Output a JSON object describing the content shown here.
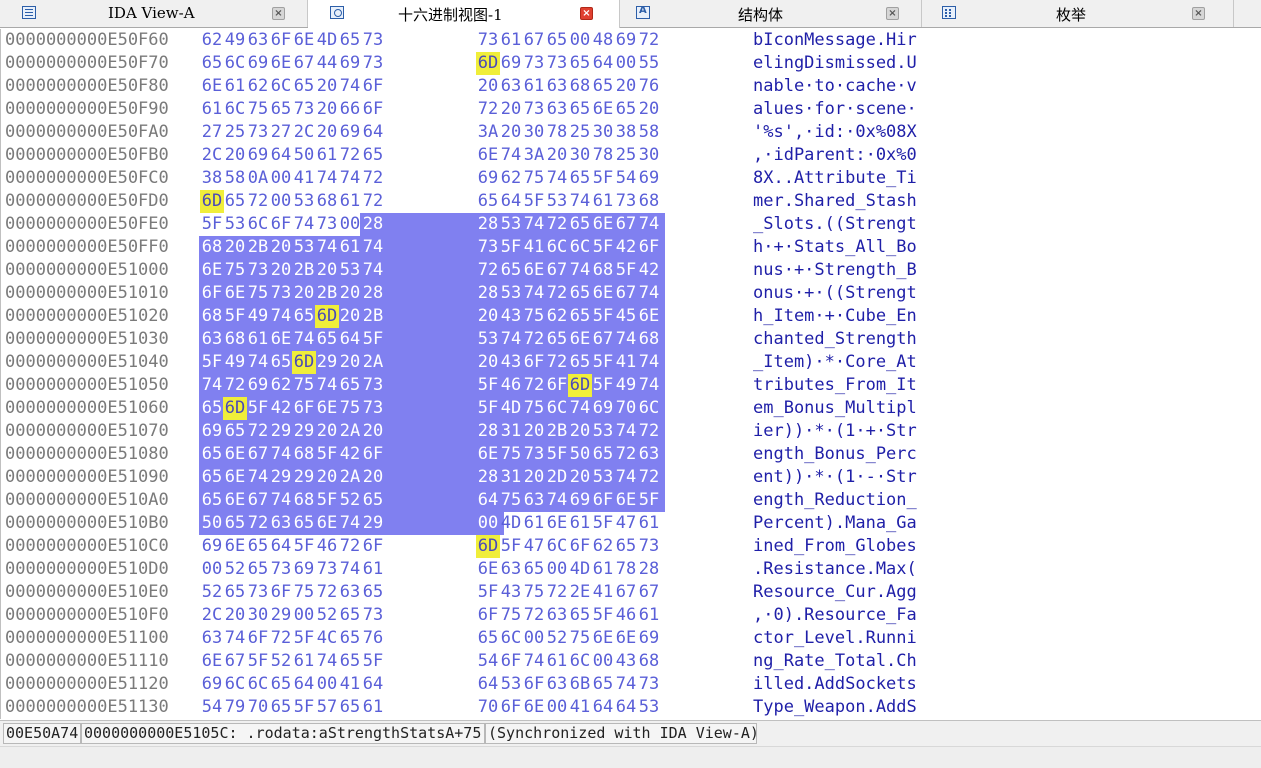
{
  "tabs": [
    {
      "label": "IDA View-A",
      "icon": "ida-view-icon",
      "active": false
    },
    {
      "label": "十六进制视图-1",
      "icon": "hex-view-icon",
      "active": true
    },
    {
      "label": "结构体",
      "icon": "structures-icon",
      "active": false
    },
    {
      "label": "枚举",
      "icon": "enums-icon",
      "active": false
    }
  ],
  "colors": {
    "hex_bytes": "#5a5fd8",
    "selection": "#8080f0",
    "search_match": "#f0ee3a",
    "ascii_text": "#1f1fa8",
    "address_text": "#7a7a7a"
  },
  "hex_rows": [
    {
      "address": "0000000000E50F60",
      "bytes": "62 49 63 6F 6E 4D 65 73 73 61 67 65 00 48 69 72",
      "ascii": "bIconMessage.Hir"
    },
    {
      "address": "0000000000E50F70",
      "bytes": "65 6C 69 6E 67 44 69 73 6D 69 73 73 65 64 00 55",
      "ascii": "elingDismissed.U"
    },
    {
      "address": "0000000000E50F80",
      "bytes": "6E 61 62 6C 65 20 74 6F 20 63 61 63 68 65 20 76",
      "ascii": "nable·to·cache·v"
    },
    {
      "address": "0000000000E50F90",
      "bytes": "61 6C 75 65 73 20 66 6F 72 20 73 63 65 6E 65 20",
      "ascii": "alues·for·scene·"
    },
    {
      "address": "0000000000E50FA0",
      "bytes": "27 25 73 27 2C 20 69 64 3A 20 30 78 25 30 38 58",
      "ascii": "'%s',·id:·0x%08X"
    },
    {
      "address": "0000000000E50FB0",
      "bytes": "2C 20 69 64 50 61 72 65 6E 74 3A 20 30 78 25 30",
      "ascii": ",·idParent:·0x%0"
    },
    {
      "address": "0000000000E50FC0",
      "bytes": "38 58 0A 00 41 74 74 72 69 62 75 74 65 5F 54 69",
      "ascii": "8X..Attribute_Ti"
    },
    {
      "address": "0000000000E50FD0",
      "bytes": "6D 65 72 00 53 68 61 72 65 64 5F 53 74 61 73 68",
      "ascii": "mer.Shared_Stash"
    },
    {
      "address": "0000000000E50FE0",
      "bytes": "5F 53 6C 6F 74 73 00 28 28 53 74 72 65 6E 67 74",
      "ascii": "_Slots.((Strengt"
    },
    {
      "address": "0000000000E50FF0",
      "bytes": "68 20 2B 20 53 74 61 74 73 5F 41 6C 6C 5F 42 6F",
      "ascii": "h·+·Stats_All_Bo"
    },
    {
      "address": "0000000000E51000",
      "bytes": "6E 75 73 20 2B 20 53 74 72 65 6E 67 74 68 5F 42",
      "ascii": "nus·+·Strength_B"
    },
    {
      "address": "0000000000E51010",
      "bytes": "6F 6E 75 73 20 2B 20 28 28 53 74 72 65 6E 67 74",
      "ascii": "onus·+·((Strengt"
    },
    {
      "address": "0000000000E51020",
      "bytes": "68 5F 49 74 65 6D 20 2B 20 43 75 62 65 5F 45 6E",
      "ascii": "h_Item·+·Cube_En"
    },
    {
      "address": "0000000000E51030",
      "bytes": "63 68 61 6E 74 65 64 5F 53 74 72 65 6E 67 74 68",
      "ascii": "chanted_Strength"
    },
    {
      "address": "0000000000E51040",
      "bytes": "5F 49 74 65 6D 29 20 2A 20 43 6F 72 65 5F 41 74",
      "ascii": "_Item)·*·Core_At"
    },
    {
      "address": "0000000000E51050",
      "bytes": "74 72 69 62 75 74 65 73 5F 46 72 6F 6D 5F 49 74",
      "ascii": "tributes_From_It"
    },
    {
      "address": "0000000000E51060",
      "bytes": "65 6D 5F 42 6F 6E 75 73 5F 4D 75 6C 74 69 70 6C",
      "ascii": "em_Bonus_Multipl"
    },
    {
      "address": "0000000000E51070",
      "bytes": "69 65 72 29 29 20 2A 20 28 31 20 2B 20 53 74 72",
      "ascii": "ier))·*·(1·+·Str"
    },
    {
      "address": "0000000000E51080",
      "bytes": "65 6E 67 74 68 5F 42 6F 6E 75 73 5F 50 65 72 63",
      "ascii": "ength_Bonus_Perc"
    },
    {
      "address": "0000000000E51090",
      "bytes": "65 6E 74 29 29 20 2A 20 28 31 20 2D 20 53 74 72",
      "ascii": "ent))·*·(1·-·Str"
    },
    {
      "address": "0000000000E510A0",
      "bytes": "65 6E 67 74 68 5F 52 65 64 75 63 74 69 6F 6E 5F",
      "ascii": "ength_Reduction_"
    },
    {
      "address": "0000000000E510B0",
      "bytes": "50 65 72 63 65 6E 74 29 00 4D 61 6E 61 5F 47 61",
      "ascii": "Percent).Mana_Ga"
    },
    {
      "address": "0000000000E510C0",
      "bytes": "69 6E 65 64 5F 46 72 6F 6D 5F 47 6C 6F 62 65 73",
      "ascii": "ined_From_Globes"
    },
    {
      "address": "0000000000E510D0",
      "bytes": "00 52 65 73 69 73 74 61 6E 63 65 00 4D 61 78 28",
      "ascii": ".Resistance.Max("
    },
    {
      "address": "0000000000E510E0",
      "bytes": "52 65 73 6F 75 72 63 65 5F 43 75 72 2E 41 67 67",
      "ascii": "Resource_Cur.Agg"
    },
    {
      "address": "0000000000E510F0",
      "bytes": "2C 20 30 29 00 52 65 73 6F 75 72 63 65 5F 46 61",
      "ascii": ",·0).Resource_Fa"
    },
    {
      "address": "0000000000E51100",
      "bytes": "63 74 6F 72 5F 4C 65 76 65 6C 00 52 75 6E 6E 69",
      "ascii": "ctor_Level.Runni"
    },
    {
      "address": "0000000000E51110",
      "bytes": "6E 67 5F 52 61 74 65 5F 54 6F 74 61 6C 00 43 68",
      "ascii": "ng_Rate_Total.Ch"
    },
    {
      "address": "0000000000E51120",
      "bytes": "69 6C 6C 65 64 00 41 64 64 53 6F 63 6B 65 74 73",
      "ascii": "illed.AddSockets"
    },
    {
      "address": "0000000000E51130",
      "bytes": "54 79 70 65 5F 57 65 61 70 6F 6E 00 41 64 64 53",
      "ascii": "Type_Weapon.AddS"
    }
  ],
  "selection": {
    "start": "0000000000E50FE7",
    "end": "0000000000E510B8"
  },
  "highlighted_byte": "6D",
  "status": {
    "offset": "00E50A74",
    "location": "0000000000E5105C: .rodata:aStrengthStatsA+75",
    "sync": "(Synchronized with IDA View-A)"
  }
}
